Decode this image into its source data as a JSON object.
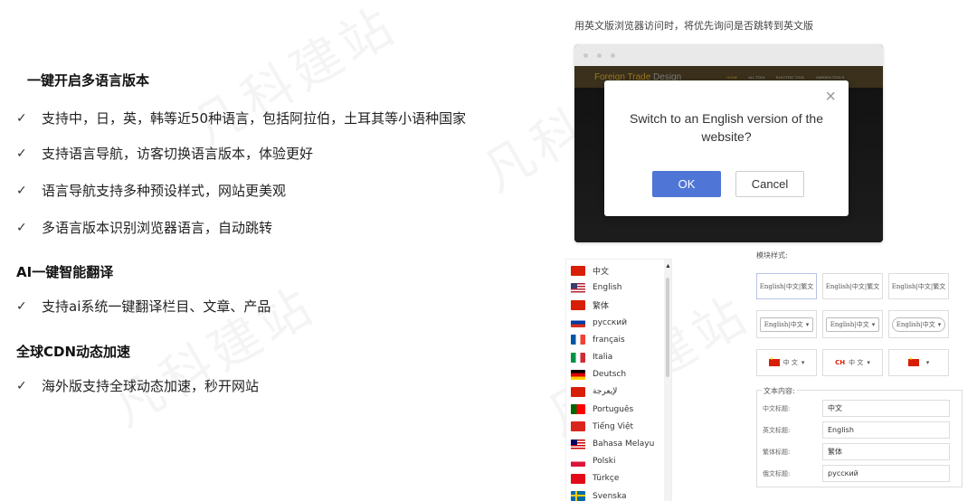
{
  "watermark": "凡科建站",
  "features": {
    "sections": [
      {
        "title": "一键开启多语言版本",
        "items": [
          "支持中，日，英，韩等近50种语言，包括阿拉伯，土耳其等小语种国家",
          "支持语言导航，访客切换语言版本，体验更好",
          "语言导航支持多种预设样式，网站更美观",
          "多语言版本识别浏览器语言，自动跳转"
        ]
      },
      {
        "title": "AI一键智能翻译",
        "items": [
          "支持ai系统一键翻译栏目、文章、产品"
        ]
      },
      {
        "title": "全球CDN动态加速",
        "items": [
          "海外版支持全球动态加速，秒开网站"
        ]
      }
    ],
    "check_glyph": "✓"
  },
  "browser_demo": {
    "caption": "用英文版浏览器访问时，将优先询问是否跳转到英文版",
    "site_brand_main": "Foreign Trade",
    "site_brand_sub": "Design",
    "site_menu": [
      "HOME",
      "ALL TOOL",
      "ELECTRIC TOOL",
      "GARDEN TOOLS"
    ],
    "dialog": {
      "message": "Switch to an English version of the website?",
      "ok_label": "OK",
      "cancel_label": "Cancel",
      "close_glyph": "×"
    }
  },
  "language_list": [
    {
      "label": "中文",
      "flag": "cn"
    },
    {
      "label": "English",
      "flag": "us"
    },
    {
      "label": "繁体",
      "flag": "cn"
    },
    {
      "label": "русский",
      "flag": "ru"
    },
    {
      "label": "français",
      "flag": "fr"
    },
    {
      "label": "Italia",
      "flag": "it"
    },
    {
      "label": "Deutsch",
      "flag": "de"
    },
    {
      "label": "لإيعرجة",
      "flag": "cn"
    },
    {
      "label": "Português",
      "flag": "pt"
    },
    {
      "label": "Tiếng Việt",
      "flag": "vn"
    },
    {
      "label": "Bahasa Melayu",
      "flag": "my"
    },
    {
      "label": "Polski",
      "flag": "pl"
    },
    {
      "label": "Türkçe",
      "flag": "tr"
    },
    {
      "label": "Svenska",
      "flag": "se"
    }
  ],
  "module_styles": {
    "label": "模块样式:",
    "row1": [
      "English|中文|繁文",
      "English|中文|繁文",
      "English|中文|繁文"
    ],
    "row2": [
      "English|中文",
      "English|中文",
      "English|中文"
    ],
    "row3": [
      "中 文",
      "中 文"
    ],
    "row3_ch_code": "CH",
    "dropdown_glyph": "▾"
  },
  "text_content": {
    "legend": "文本内容:",
    "fields": [
      {
        "label": "中文标题:",
        "value": "中文"
      },
      {
        "label": "英文标题:",
        "value": "English"
      },
      {
        "label": "繁体标题:",
        "value": "繁体"
      },
      {
        "label": "俄文标题:",
        "value": "русский"
      }
    ]
  },
  "colors": {
    "ok_button": "#4f76d6",
    "brand_gold": "#e8b838",
    "flag_red": "#d81e06"
  }
}
